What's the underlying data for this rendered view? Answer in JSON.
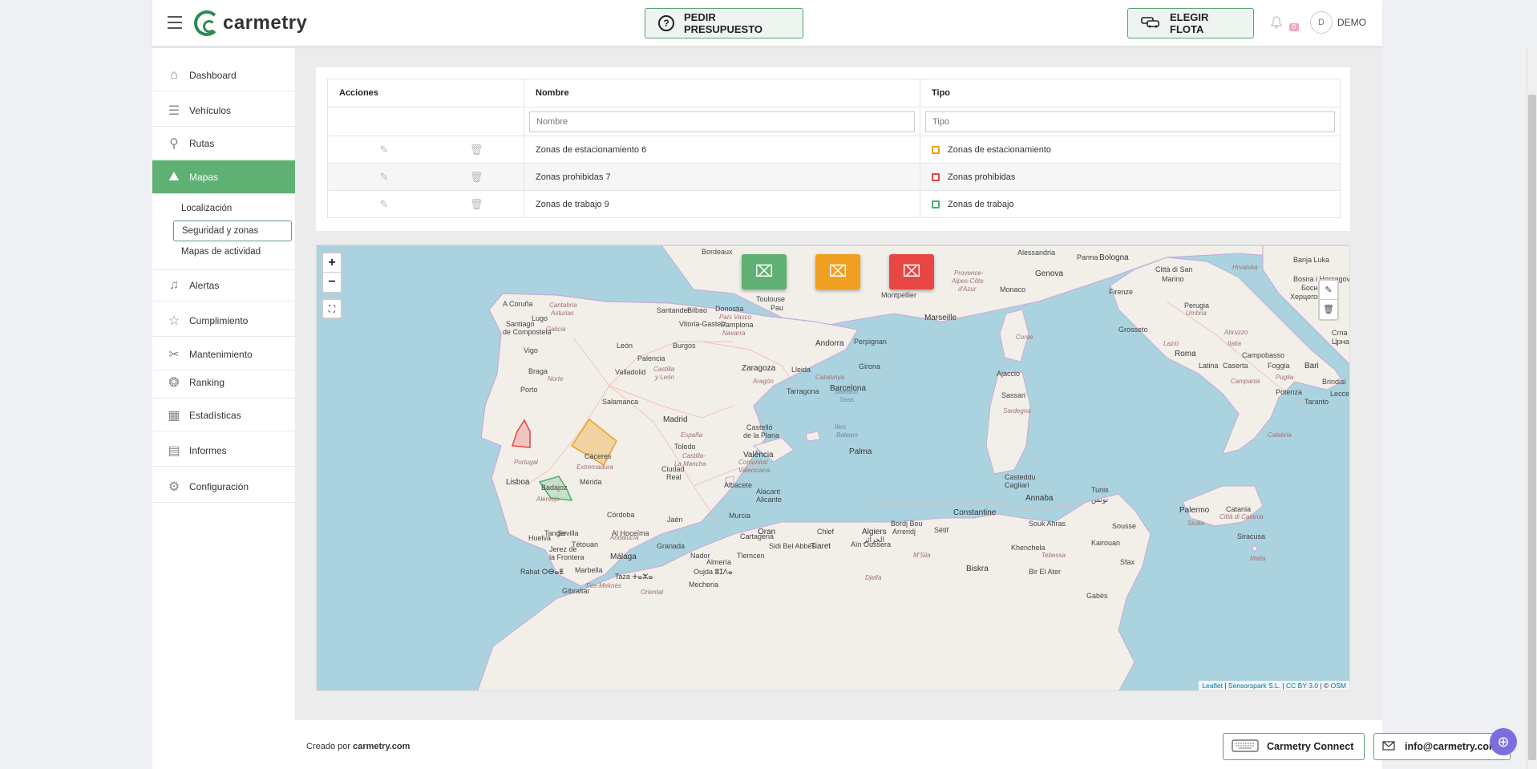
{
  "header": {
    "logo_text": "carmetry",
    "presupuesto_label": "PEDIR PRESUPUESTO",
    "flota_label": "ELEGIR FLOTA",
    "notification_count": "0",
    "avatar_initial": "D",
    "user_name": "DEMO"
  },
  "sidebar": {
    "items": [
      {
        "label": "Dashboard",
        "icon": "home-icon"
      },
      {
        "label": "Vehículos",
        "icon": "list-icon"
      },
      {
        "label": "Rutas",
        "icon": "route-icon"
      },
      {
        "label": "Mapas",
        "icon": "map-icon"
      },
      {
        "label": "Alertas",
        "icon": "bell-icon"
      },
      {
        "label": "Cumplimiento",
        "icon": "star-icon"
      },
      {
        "label": "Mantenimiento",
        "icon": "tools-icon"
      },
      {
        "label": "Ranking",
        "icon": "medal-icon"
      },
      {
        "label": "Estadísticas",
        "icon": "chart-icon"
      },
      {
        "label": "Informes",
        "icon": "report-icon"
      },
      {
        "label": "Configuración",
        "icon": "gear-icon"
      }
    ],
    "sub_items": [
      "Localización",
      "Seguridad y zonas",
      "Mapas de actividad"
    ]
  },
  "table": {
    "headers": [
      "Acciones",
      "Nombre",
      "Tipo"
    ],
    "filter_placeholders": [
      "Nombre",
      "Tipo"
    ],
    "rows": [
      {
        "nombre": "Zonas de estacionamiento 6",
        "tipo": "Zonas de estacionamiento",
        "color": "#f0a020"
      },
      {
        "nombre": "Zonas prohibidas 7",
        "tipo": "Zonas prohibidas",
        "color": "#e84545"
      },
      {
        "nombre": "Zonas de trabajo 9",
        "tipo": "Zonas de trabajo",
        "color": "#4caf6a"
      }
    ]
  },
  "map": {
    "zoom_in": "+",
    "zoom_out": "−",
    "draw_buttons": [
      {
        "name": "trabajo",
        "color": "#5fb173"
      },
      {
        "name": "estacionamiento",
        "color": "#f0a020"
      },
      {
        "name": "prohibidas",
        "color": "#e84545"
      }
    ],
    "attribution": {
      "leaflet": "Leaflet",
      "sep1": " | ",
      "sensorspark": "Sensorspark S.L.",
      "sep2": " | ",
      "cc": "CC BY 3.0",
      "sep3": " | © ",
      "osm": "OSM"
    },
    "labels": {
      "bordeaux": "Bordeaux",
      "toulouse": "Toulouse",
      "pau": "Pau",
      "montpellier": "Montpellier",
      "marseille": "Marseille",
      "monaco": "Monaco",
      "genova": "Genova",
      "alessandria": "Alessandria",
      "parma": "Parma",
      "bologna": "Bologna",
      "firenze": "Firenze",
      "citta_san_marino": "Città di San",
      "marino": "Marino",
      "hrvatska": "Hrvatska",
      "banja_luka": "Banja Luka",
      "bosna": "Bosna i Hercegovina",
      "bosna_cyr": "Босна и",
      "hercegovina_cyr": "Херцеговина",
      "crna_gora": "Crna Go",
      "crna_gora_cyr": "Црна Го",
      "provence": "Provence-",
      "alpes": "Alpes-Côte",
      "azur": "d'Azur",
      "a_coruna": "A Coruña",
      "santander": "Santander",
      "bilbao": "Bilbao",
      "donostia": "Donostia",
      "vitoria": "Vitoria-Gasteiz",
      "cantabria": "Cantabria",
      "asturias": "Asturias",
      "santiago": "Santiago",
      "compostela": "de Compostela",
      "galicia": "Galicia",
      "lugo": "Lugo",
      "pais_vasco": "País Vasco",
      "navarra": "Navarra",
      "pamplona": "Pamplona",
      "leon": "León",
      "burgos": "Burgos",
      "andorra": "Andorra",
      "perpignan": "Perpignan",
      "vigo": "Vigo",
      "palencia": "Palencia",
      "zaragoza": "Zaragoza",
      "girona": "Girona",
      "braga": "Braga",
      "porto": "Porto",
      "norte": "Norte",
      "valladolid": "Valladolid",
      "castilla": "Castilla",
      "y_leon": "y León",
      "lleida": "Lleida",
      "catalunya": "Catalunya",
      "barcelona": "Barcelona",
      "tarragona": "Tarragona",
      "aragon": "Aragón",
      "salamanca": "Salamanca",
      "madrid": "Madrid",
      "espana": "España",
      "castello": "Castelló",
      "de_la_plana": "de la Plana",
      "toledo": "Toledo",
      "valencia": "València",
      "comunitat": "Comunitat",
      "valenciana": "Valenciana",
      "portugal": "Portugal",
      "caceres": "Cáceres",
      "extremadura": "Extremadura",
      "castilla_la_mancha": "Castilla-",
      "la_mancha": "La Mancha",
      "ciudad_real": "Ciudad",
      "real": "Real",
      "lisboa": "Lisboa",
      "badajoz": "Badajoz",
      "merida": "Mérida",
      "alentejo": "Alentejo",
      "albacete": "Albacete",
      "alacant": "Alacant",
      "alicante": "Alicante",
      "cordoba": "Córdoba",
      "jaen": "Jaén",
      "murcia": "Murcia",
      "cartagena": "Cartagena",
      "sevilla": "Sevilla",
      "huelva": "Huelva",
      "andalucia": "Andalucía",
      "granada": "Granada",
      "almeria": "Almería",
      "jerez": "Jerez de",
      "la_frontera": "la Frontera",
      "malaga": "Málaga",
      "marbella": "Marbella",
      "gibraltar": "Gibraltar",
      "palma": "Palma",
      "balears": "Illes",
      "balears2": "Balears",
      "ajaccio": "Ajaccio",
      "corse": "Corse",
      "sassari": "Sassari",
      "sardegna": "Sardegna",
      "cagliari": "Casteddu",
      "cagliari2": "Cagliari",
      "grosseto": "Grosseto",
      "perugia": "Perugia",
      "umbria": "Umbria",
      "abruzzo": "Abruzzo",
      "lazio": "Lazio",
      "roma": "Roma",
      "italia": "Italia",
      "campobasso": "Campobasso",
      "latina": "Latina",
      "caserta": "Caserta",
      "bari": "Bari",
      "foggia": "Foggia",
      "puglia": "Puglia",
      "campania": "Campania",
      "potenza": "Potenza",
      "brindisi": "Brindisi",
      "lecce": "Lecce",
      "taranto": "Taranto",
      "calabria": "Calabria",
      "palermo": "Palermo",
      "sicilia": "Sicilia",
      "siracusa": "Siracusa",
      "malta": "Malta",
      "catania": "Catania",
      "citta_catania": "Città di Catania",
      "algiers": "Algiers",
      "alger": "الجزائر",
      "annaba": "Annaba",
      "constantine": "Constantine",
      "tunis": "Tunis",
      "tunis_ar": "تونس",
      "souk_ahras": "Souk Ahras",
      "setif": "Sétif",
      "bordj": "Bordj Bou",
      "arreridj": "Arreridj",
      "tiaret": "Tiaret",
      "chlef": "Chlef",
      "oran": "Oran",
      "tlemcen": "Tlemcen",
      "sidi_bel_abbes": "Sidi Bel Abbès",
      "nador": "Nador",
      "oujda": "Oujda ⵓⵊⴷⴰ",
      "tetouan": "Tétouan",
      "tanger": "Tanger",
      "al_hoceima": "Al Hoceïma",
      "rabat": "Rabat ⵔⴱⴰⵟ",
      "fes": "Fès-Meknès",
      "taza": "Taza ⵜⴰⵣⴰ",
      "oriental": "Oriental",
      "mecheria": "Mecheria",
      "biskra": "Biskra",
      "djelfa": "Djelfa",
      "khenchela": "Khenchela",
      "tebessa": "Tebessa",
      "bir_el_ater": "Bir El Ater",
      "m_sila": "M'Sila",
      "ain_oussera": "Aïn Oussera",
      "sousse": "Sousse",
      "kairouan": "Kairouan",
      "sfax": "Sfax",
      "gabes": "Gabès",
      "baleares_sea": "Baleario",
      "baleares_sea2": "Seas"
    }
  },
  "footer": {
    "created_by": "Creado por ",
    "site": "carmetry.com",
    "connect_label": "Carmetry Connect",
    "email_label": "info@carmetry.com"
  }
}
